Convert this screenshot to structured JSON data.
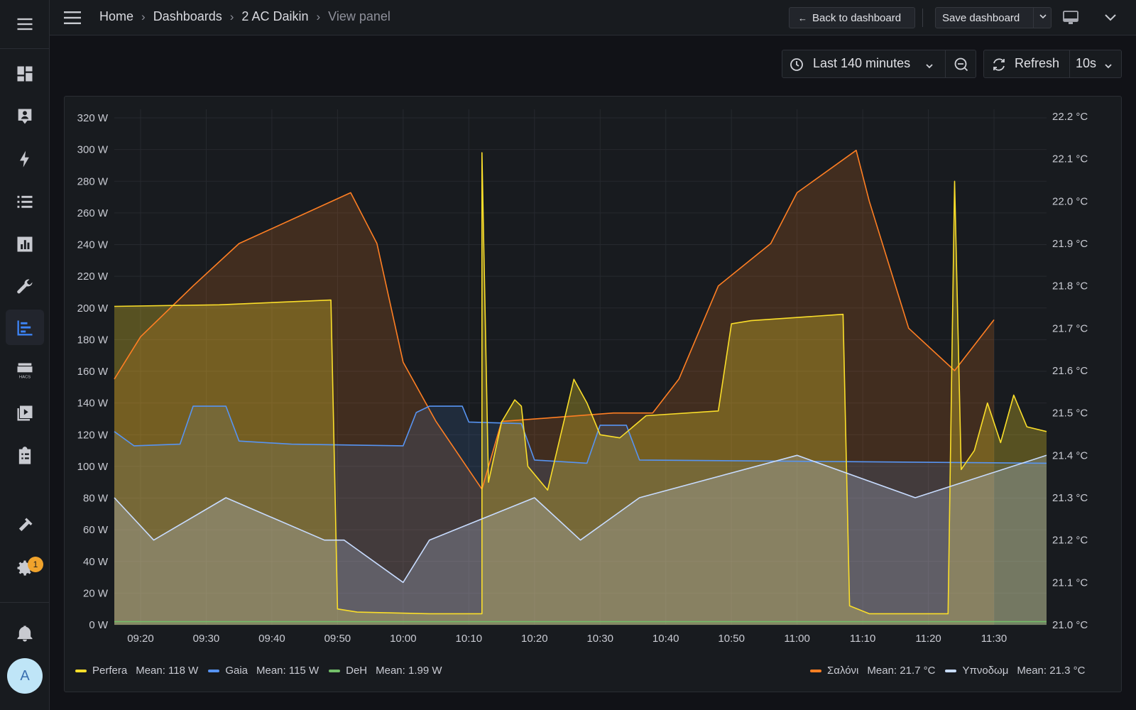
{
  "sidebar": {
    "items": [
      {
        "icon": "hamburger-icon"
      },
      {
        "icon": "overview-icon"
      },
      {
        "icon": "map-icon"
      },
      {
        "icon": "energy-icon"
      },
      {
        "icon": "logbook-icon"
      },
      {
        "icon": "history-icon"
      },
      {
        "icon": "wrench-icon"
      },
      {
        "icon": "grafana-icon"
      },
      {
        "icon": "hacs-icon"
      },
      {
        "icon": "media-icon"
      },
      {
        "icon": "todo-icon"
      },
      {
        "icon": "developer-tools-icon"
      },
      {
        "icon": "settings-icon"
      },
      {
        "icon": "notifications-icon"
      }
    ],
    "settings_badge": "1",
    "avatar_letter": "A"
  },
  "header": {
    "breadcrumbs": [
      "Home",
      "Dashboards",
      "2 AC Daikin",
      "View panel"
    ],
    "back_label": "Back to dashboard",
    "save_label": "Save dashboard"
  },
  "controls": {
    "time_range": "Last 140 minutes",
    "refresh_label": "Refresh",
    "refresh_interval": "10s"
  },
  "chart_data": {
    "type": "line",
    "x_start": "09:16",
    "x_end": "11:38",
    "x_ticks": [
      "09:20",
      "09:30",
      "09:40",
      "09:50",
      "10:00",
      "10:10",
      "10:20",
      "10:30",
      "10:40",
      "10:50",
      "11:00",
      "11:10",
      "11:20",
      "11:30"
    ],
    "y_left": {
      "unit": "W",
      "min": 0,
      "max": 320,
      "ticks": [
        "0 W",
        "20 W",
        "40 W",
        "60 W",
        "80 W",
        "100 W",
        "120 W",
        "140 W",
        "160 W",
        "180 W",
        "200 W",
        "220 W",
        "240 W",
        "260 W",
        "280 W",
        "300 W",
        "320 W"
      ]
    },
    "y_right": {
      "unit": "°C",
      "min": 21.0,
      "max": 22.2,
      "ticks": [
        "21.0 °C",
        "21.1 °C",
        "21.2 °C",
        "21.3 °C",
        "21.4 °C",
        "21.5 °C",
        "21.6 °C",
        "21.7 °C",
        "21.8 °C",
        "21.9 °C",
        "22.0 °C",
        "22.1 °C",
        "22.2 °C"
      ]
    },
    "series": [
      {
        "name": "Perfera",
        "axis": "left",
        "color": "#fade2a",
        "mean": "Mean: 118 W",
        "points": [
          [
            "09:16",
            201
          ],
          [
            "09:32",
            202
          ],
          [
            "09:49",
            205
          ],
          [
            "09:50",
            10
          ],
          [
            "09:53",
            8
          ],
          [
            "10:04",
            7
          ],
          [
            "10:12",
            7
          ],
          [
            "10:12",
            298
          ],
          [
            "10:13",
            90
          ],
          [
            "10:15",
            128
          ],
          [
            "10:17",
            142
          ],
          [
            "10:18",
            138
          ],
          [
            "10:19",
            100
          ],
          [
            "10:22",
            85
          ],
          [
            "10:24",
            120
          ],
          [
            "10:26",
            155
          ],
          [
            "10:28",
            140
          ],
          [
            "10:30",
            120
          ],
          [
            "10:33",
            118
          ],
          [
            "10:37",
            132
          ],
          [
            "10:48",
            135
          ],
          [
            "10:50",
            190
          ],
          [
            "10:53",
            192
          ],
          [
            "11:07",
            196
          ],
          [
            "11:08",
            12
          ],
          [
            "11:11",
            7
          ],
          [
            "11:23",
            7
          ],
          [
            "11:24",
            280
          ],
          [
            "11:25",
            98
          ],
          [
            "11:27",
            110
          ],
          [
            "11:29",
            140
          ],
          [
            "11:31",
            115
          ],
          [
            "11:33",
            145
          ],
          [
            "11:35",
            125
          ],
          [
            "11:38",
            122
          ]
        ]
      },
      {
        "name": "Gaia",
        "axis": "left",
        "color": "#5794f2",
        "mean": "Mean: 115 W",
        "points": [
          [
            "09:16",
            122
          ],
          [
            "09:19",
            113
          ],
          [
            "09:26",
            114
          ],
          [
            "09:28",
            138
          ],
          [
            "09:33",
            138
          ],
          [
            "09:35",
            116
          ],
          [
            "09:43",
            114
          ],
          [
            "10:00",
            113
          ],
          [
            "10:02",
            134
          ],
          [
            "10:04",
            138
          ],
          [
            "10:09",
            138
          ],
          [
            "10:10",
            128
          ],
          [
            "10:18",
            127
          ],
          [
            "10:20",
            104
          ],
          [
            "10:28",
            102
          ],
          [
            "10:30",
            126
          ],
          [
            "10:34",
            126
          ],
          [
            "10:36",
            104
          ],
          [
            "11:38",
            102
          ]
        ]
      },
      {
        "name": "DeH",
        "axis": "left",
        "color": "#73bf69",
        "mean": "Mean: 1.99 W",
        "points": [
          [
            "09:16",
            2
          ],
          [
            "11:38",
            2
          ]
        ]
      },
      {
        "name": "Σαλόνι",
        "axis": "right",
        "color": "#ff7f23",
        "mean": "Mean: 21.7 °C",
        "points": [
          [
            "09:16",
            21.58
          ],
          [
            "09:20",
            21.68
          ],
          [
            "09:28",
            21.8
          ],
          [
            "09:35",
            21.9
          ],
          [
            "09:52",
            22.02
          ],
          [
            "09:56",
            21.9
          ],
          [
            "10:00",
            21.62
          ],
          [
            "10:05",
            21.48
          ],
          [
            "10:12",
            21.32
          ],
          [
            "10:15",
            21.48
          ],
          [
            "10:32",
            21.5
          ],
          [
            "10:35",
            21.5
          ],
          [
            "10:38",
            21.5
          ],
          [
            "10:42",
            21.58
          ],
          [
            "10:48",
            21.8
          ],
          [
            "10:56",
            21.9
          ],
          [
            "11:00",
            22.02
          ],
          [
            "11:09",
            22.12
          ],
          [
            "11:11",
            22.0
          ],
          [
            "11:17",
            21.7
          ],
          [
            "11:24",
            21.6
          ],
          [
            "11:30",
            21.72
          ]
        ]
      },
      {
        "name": "Υπνοδωμ",
        "axis": "right",
        "color": "#c8dcff",
        "mean": "Mean: 21.3 °C",
        "points": [
          [
            "09:16",
            21.3
          ],
          [
            "09:22",
            21.2
          ],
          [
            "09:33",
            21.3
          ],
          [
            "09:48",
            21.2
          ],
          [
            "09:51",
            21.2
          ],
          [
            "10:00",
            21.1
          ],
          [
            "10:04",
            21.2
          ],
          [
            "10:20",
            21.3
          ],
          [
            "10:27",
            21.2
          ],
          [
            "10:36",
            21.3
          ],
          [
            "11:00",
            21.4
          ],
          [
            "11:18",
            21.3
          ],
          [
            "11:38",
            21.4
          ]
        ]
      }
    ]
  }
}
